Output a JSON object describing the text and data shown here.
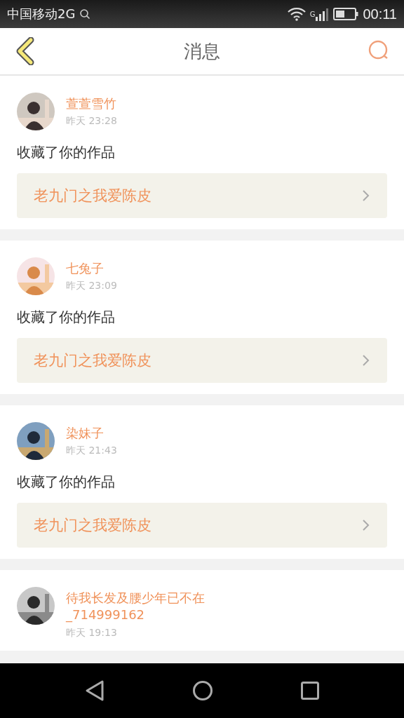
{
  "status_bar": {
    "carrier": "中国移动2G",
    "network_type": "G",
    "time": "00:11"
  },
  "header": {
    "title": "消息"
  },
  "messages": [
    {
      "user": "萱萱雪竹",
      "time": "昨天 23:28",
      "action": "收藏了你的作品",
      "work": "老九门之我爱陈皮"
    },
    {
      "user": "七兔子",
      "time": "昨天 23:09",
      "action": "收藏了你的作品",
      "work": "老九门之我爱陈皮"
    },
    {
      "user": "染妹子",
      "time": "昨天 21:43",
      "action": "收藏了你的作品",
      "work": "老九门之我爱陈皮"
    },
    {
      "user": "待我长发及腰少年已不在_714999162",
      "time": "昨天 19:13"
    }
  ]
}
